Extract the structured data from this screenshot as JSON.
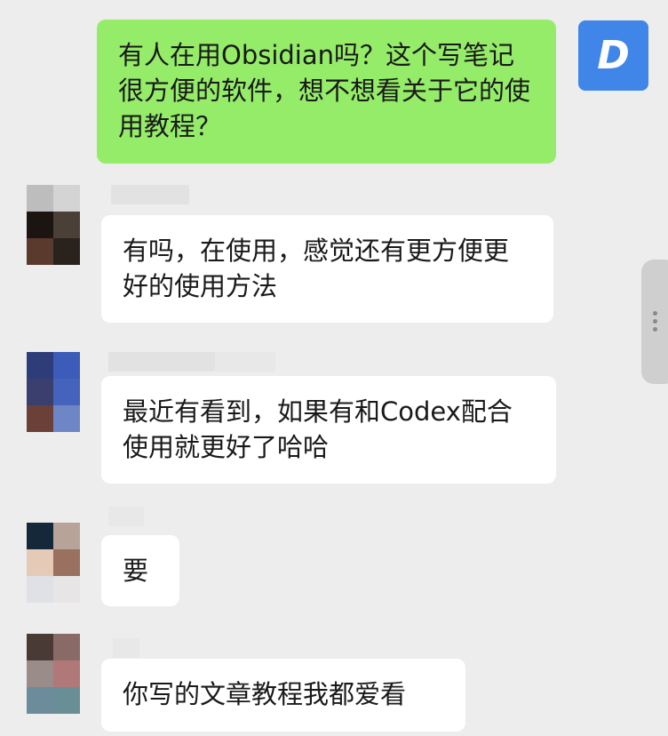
{
  "messages": [
    {
      "sender": "me",
      "avatar_letter": "D",
      "text": "有人在用Obsidian吗？这个写笔记很方便的软件，想不想看关于它的使用教程？"
    },
    {
      "sender": "other",
      "text": "有吗，在使用，感觉还有更方便更好的使用方法"
    },
    {
      "sender": "other",
      "text": "最近有看到，如果有和Codex配合使用就更好了哈哈"
    },
    {
      "sender": "other",
      "text": "要"
    },
    {
      "sender": "other",
      "text": "你写的文章教程我都爱看"
    }
  ],
  "colors": {
    "background": "#ededed",
    "my_bubble": "#95ec69",
    "other_bubble": "#ffffff",
    "my_avatar": "#3f86e8"
  },
  "icons": {
    "side_handle": "more-vertical-icon"
  }
}
